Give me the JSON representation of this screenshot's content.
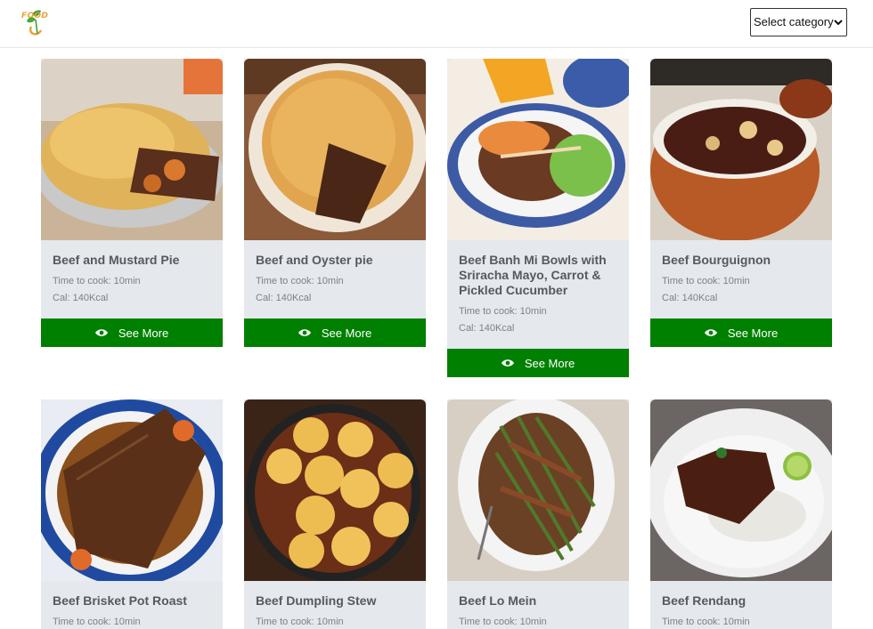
{
  "header": {
    "logo_text": "FOOD",
    "category_select": {
      "selected": "Select category"
    }
  },
  "colors": {
    "accent": "#008000",
    "card_bg": "#e5e8ec",
    "logo_orange": "#e8a33c",
    "logo_green": "#3a9a2a"
  },
  "recipes": [
    {
      "title": "Beef and Mustard Pie",
      "time": "Time to cook: 10min",
      "cal": "Cal: 140Kcal",
      "button": "See More",
      "icon": "eye-icon"
    },
    {
      "title": "Beef and Oyster pie",
      "time": "Time to cook: 10min",
      "cal": "Cal: 140Kcal",
      "button": "See More",
      "icon": "eye-icon"
    },
    {
      "title": "Beef Banh Mi Bowls with Sriracha Mayo, Carrot & Pickled Cucumber",
      "time": "Time to cook: 10min",
      "cal": "Cal: 140Kcal",
      "button": "See More",
      "icon": "eye-icon"
    },
    {
      "title": "Beef Bourguignon",
      "time": "Time to cook: 10min",
      "cal": "Cal: 140Kcal",
      "button": "See More",
      "icon": "eye-icon"
    },
    {
      "title": "Beef Brisket Pot Roast",
      "time": "Time to cook: 10min"
    },
    {
      "title": "Beef Dumpling Stew",
      "time": "Time to cook: 10min"
    },
    {
      "title": "Beef Lo Mein",
      "time": "Time to cook: 10min"
    },
    {
      "title": "Beef Rendang",
      "time": "Time to cook: 10min"
    }
  ]
}
